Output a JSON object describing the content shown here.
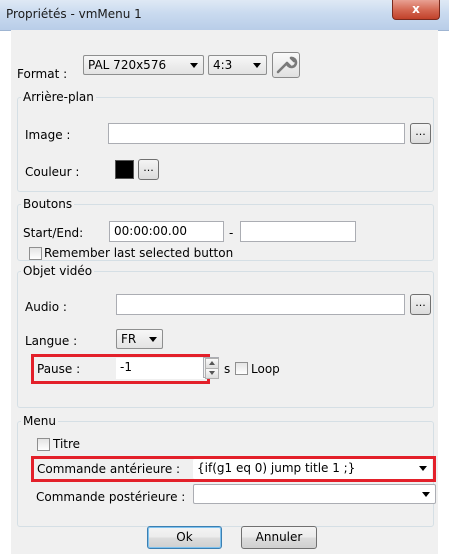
{
  "window": {
    "title": "Propriétés - vmMenu 1",
    "close_label": "x"
  },
  "format": {
    "label": "Format :",
    "resolution": "PAL 720x576",
    "aspect": "4:3"
  },
  "background": {
    "title": "Arrière-plan",
    "image_label": "Image :",
    "image_value": "",
    "browse_label": "...",
    "color_label": "Couleur :",
    "color_value": "#000000",
    "color_button_label": "..."
  },
  "buttons": {
    "title": "Boutons",
    "start_end_label": "Start/End:",
    "start_value": "00:00:00.00",
    "separator": "-",
    "end_value": "",
    "remember_label": "Remember last selected button"
  },
  "video_object": {
    "title": "Objet vidéo",
    "audio_label": "Audio :",
    "audio_value": "",
    "audio_browse_label": "...",
    "language_label": "Langue :",
    "language_value": "FR",
    "pause_label": "Pause :",
    "pause_value": "-1",
    "pause_unit": "s",
    "loop_label": "Loop"
  },
  "menu": {
    "title": "Menu",
    "title_checkbox_label": "Titre",
    "pre_command_label": "Commande antérieure :",
    "pre_command_value": "{if(g1 eq 0) jump title 1 ;}",
    "post_command_label": "Commande postérieure :",
    "post_command_value": ""
  },
  "actions": {
    "ok_label": "Ok",
    "cancel_label": "Annuler"
  },
  "colors": {
    "highlight": "#e3202a",
    "title_bar": "#c9daef",
    "dialog_bg": "#f0f0f0"
  }
}
